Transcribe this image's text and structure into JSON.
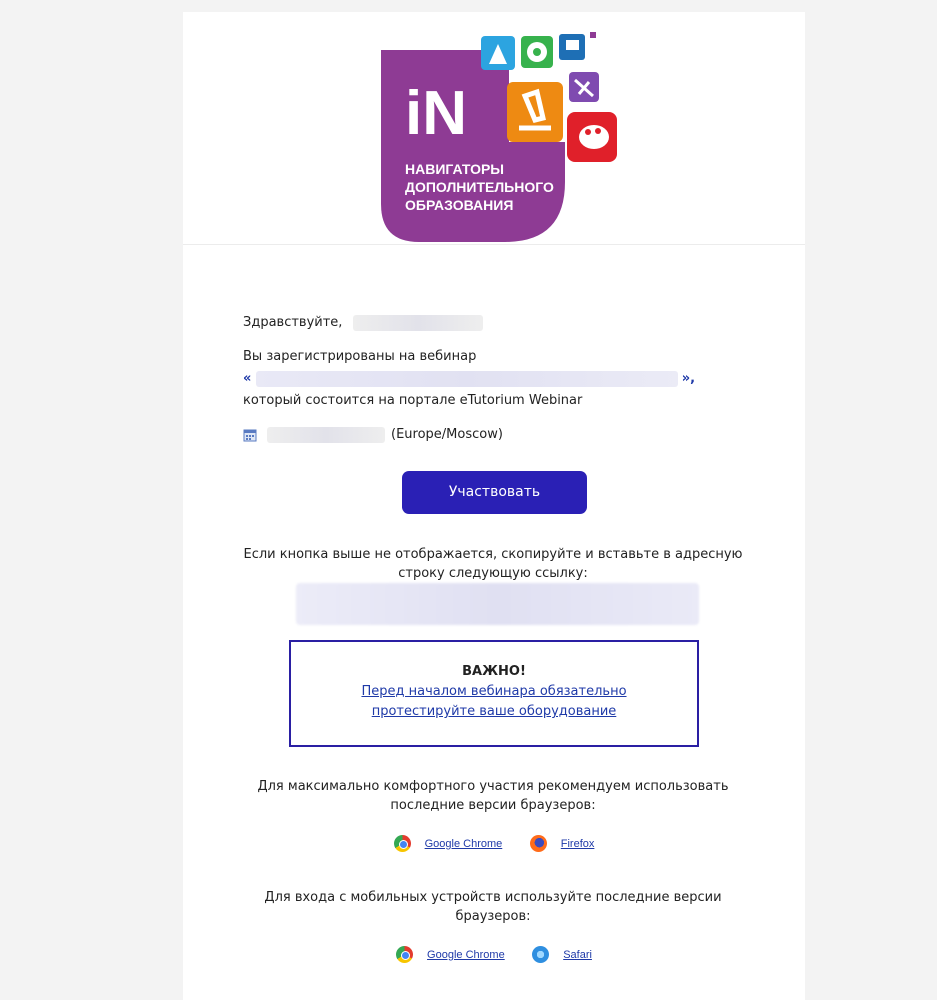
{
  "logo": {
    "big_text": "iN",
    "lines": [
      "НАВИГАТОРЫ",
      "ДОПОЛНИТЕЛЬНОГО",
      "ОБРАЗОВАНИЯ"
    ],
    "brand_color": "#8e3b94",
    "tile_colors": [
      "#2ca4e0",
      "#37b24d",
      "#1e6fb5",
      "#ee8a12",
      "#7f4bb0",
      "#e0202a"
    ]
  },
  "greeting": "Здравствуйте,",
  "registered_text": "Вы зарегистрированы на вебинар",
  "quote_open": "«",
  "quote_close": "»,",
  "portal_text": "который состоится на портале eTutorium Webinar",
  "timezone": "(Europe/Moscow)",
  "cta_button": "Участвовать",
  "fallback_note": "Если кнопка выше не отображается, скопируйте и вставьте в адресную строку следующую ссылку:",
  "important": {
    "title": "ВАЖНО!",
    "link_line1": "Перед началом вебинара обязательно",
    "link_line2": "протестируйте ваше оборудование"
  },
  "desktop_recommendation": "Для максимально комфортного участия рекомендуем использовать последние версии браузеров:",
  "desktop_browsers": [
    {
      "name": "Google Chrome",
      "icon": "chrome-icon"
    },
    {
      "name": "Firefox",
      "icon": "firefox-icon"
    }
  ],
  "mobile_recommendation": "Для входа с мобильных устройств используйте последние версии браузеров:",
  "mobile_browsers": [
    {
      "name": "Google Chrome",
      "icon": "chrome-icon"
    },
    {
      "name": "Safari",
      "icon": "safari-icon"
    }
  ],
  "accent_color": "#2a20b5"
}
